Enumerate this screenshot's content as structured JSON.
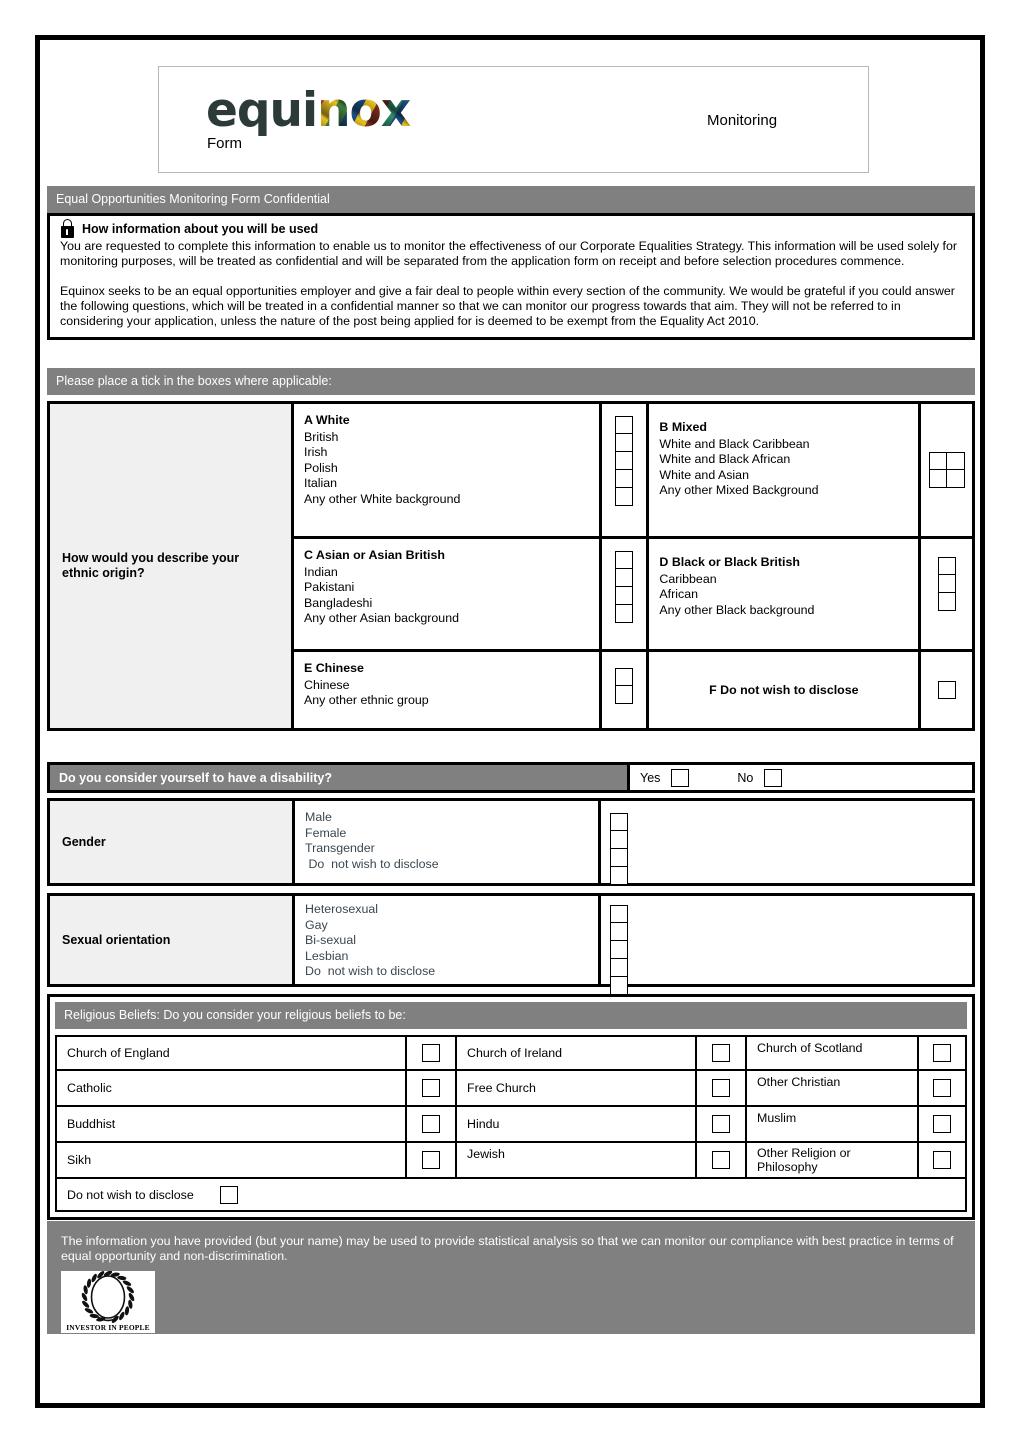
{
  "masthead": {
    "logo_left": "equi",
    "logo_right": "nox",
    "form_label": "Form",
    "monitoring_label": "Monitoring"
  },
  "title_bar": "Equal Opportunities Monitoring Form  Confidential",
  "intro": {
    "heading": "How information about you will be used",
    "paragraph1": "You are requested to complete this information to enable us to monitor the effectiveness of our Corporate Equalities Strategy. This information will be used solely for monitoring purposes, will be treated as confidential and will be separated from the application form on receipt and before selection procedures commence.",
    "paragraph2": "Equinox seeks to be an equal opportunities employer and give a fair deal to people within every section of the community.  We would be grateful if you could answer the following questions, which will be treated in a confidential manner so that we can monitor our progress towards that aim.  They will not be referred to in considering your application, unless the nature of the post being applied for is deemed to be exempt from the Equality Act 2010."
  },
  "tick_bar": "Please place a tick in the boxes where applicable:",
  "ethnic": {
    "question": "How would you describe your ethnic origin?",
    "group_a": {
      "title": "A  White",
      "options": [
        "British",
        "Irish",
        "Polish",
        "Italian",
        "Any other White background"
      ]
    },
    "group_b": {
      "title": "B  Mixed",
      "options": [
        "White and Black Caribbean",
        "White and Black African",
        "White and Asian",
        "Any other Mixed Background"
      ]
    },
    "group_c": {
      "title": "C  Asian or Asian British",
      "options": [
        "Indian",
        "Pakistani",
        "Bangladeshi",
        "Any other Asian background"
      ]
    },
    "group_d": {
      "title": "D  Black or Black British",
      "options": [
        "Caribbean",
        "African",
        "Any other Black background"
      ]
    },
    "group_e": {
      "title": "E  Chinese",
      "options": [
        "Chinese",
        "Any other ethnic group"
      ]
    },
    "group_f": {
      "title": "F  Do not wish to disclose"
    }
  },
  "disability": {
    "question": "Do you consider yourself to have a disability?",
    "yes_label": "Yes",
    "no_label": "No"
  },
  "gender": {
    "label": "Gender",
    "options": [
      "Male",
      "Female",
      "Transgender",
      " Do  not wish to disclose"
    ]
  },
  "sexual_orientation": {
    "label": "Sexual orientation",
    "options": [
      "Heterosexual",
      "Gay",
      "Bi-sexual",
      "Lesbian",
      "Do  not wish to disclose"
    ]
  },
  "religion": {
    "bar": "Religious Beliefs:  Do you consider your religious beliefs to be:",
    "rows": [
      {
        "c1": "Church of England",
        "c2": "Church of Ireland",
        "c3": "Church of Scotland",
        "a1": "center",
        "a2": "center",
        "a3": "top"
      },
      {
        "c1": "Catholic",
        "c2": "Free Church",
        "c3": "Other Christian",
        "a1": "center",
        "a2": "center",
        "a3": "top"
      },
      {
        "c1": "Buddhist",
        "c2": "Hindu",
        "c3": "Muslim",
        "a1": "center",
        "a2": "center",
        "a3": "top"
      },
      {
        "c1": "Sikh",
        "c2": "Jewish",
        "c3": "Other Religion or Philosophy",
        "a1": "center",
        "a2": "top",
        "a3": "center"
      }
    ],
    "last_option": "Do not wish to disclose"
  },
  "footer": {
    "text": "The information you have provided (but your name) may be used to provide statistical analysis so that we can monitor our compliance with best practice in terms of equal opportunity and non-discrimination.",
    "iip_caption": "INVESTOR IN PEOPLE"
  }
}
